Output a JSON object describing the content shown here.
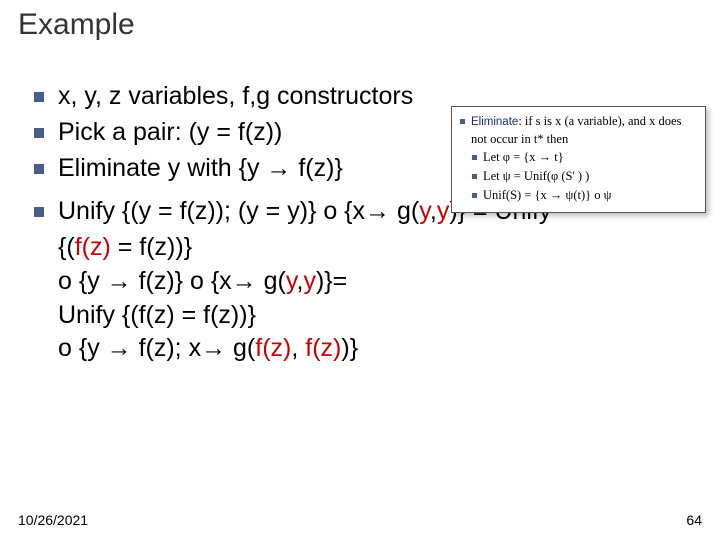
{
  "title": "Example",
  "bullets": {
    "b1": "x, y, z variables, f,g constructors",
    "b2": "Pick a pair: (y = f(z))",
    "b3": "Eliminate y with {y → f(z)}"
  },
  "main": {
    "line1_a": "Unify {(y = f(z)); (y = y)} o {x→ g(",
    "line1_b": "y",
    "line1_c": ",",
    "line1_d": "y",
    "line1_e": ")} = Unify",
    "line2_a": "{(",
    "line2_b": "f(z)",
    "line2_c": " = f(z))}",
    "line3_a": " o {y → f(z)} o {x→ g(",
    "line3_b": "y",
    "line3_c": ",",
    "line3_d": "y",
    "line3_e": ")}=",
    "line4": "Unify {(f(z) = f(z))}",
    "line5_a": " o {y → f(z); x→ g(",
    "line5_b": "f(z)",
    "line5_c": ", ",
    "line5_d": "f(z)",
    "line5_e": ")}"
  },
  "inset": {
    "i1_a": "Eliminate",
    "i1_b": ": if s is x (a variable), and x does not occur in t* then",
    "i2_a": "Let ",
    "i2_b": "φ = {x → t}",
    "i3_a": "Let ",
    "i3_b": "ψ = Unif(φ (S' ) )",
    "i4_a": "Unif(S) = {x → ψ(t)} o ψ"
  },
  "footer": {
    "date": "10/26/2021",
    "page": "64"
  }
}
